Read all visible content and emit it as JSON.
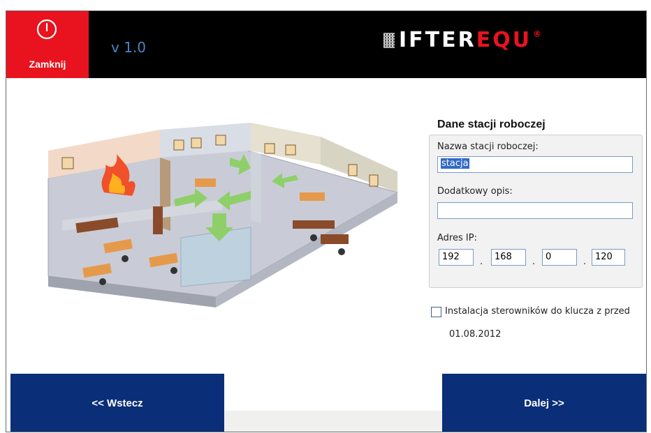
{
  "header": {
    "close_label": "Zamknij",
    "version": "v 1.0",
    "logo_white": "IFTER",
    "logo_red": "EQU",
    "logo_reg": "®"
  },
  "form": {
    "title": "Dane stacji roboczej",
    "station_name_label": "Nazwa stacji roboczej:",
    "station_name_value": "stacja",
    "description_label": "Dodatkowy opis:",
    "description_value": "",
    "ip_label": "Adres IP:",
    "ip": [
      "192",
      "168",
      "0",
      "120"
    ],
    "ip_separator": ".",
    "driver_checkbox_label": "Instalacja sterowników do klucza z przed",
    "driver_checkbox_checked": false,
    "date": "01.08.2012"
  },
  "nav": {
    "back_label": "<< Wstecz",
    "next_label": "Dalej >>"
  },
  "colors": {
    "close_red": "#e8131e",
    "nav_blue": "#0b2e78",
    "version_blue": "#4a86c8"
  },
  "icons": {
    "close": "power-icon",
    "logo": "ifter-logo-icon",
    "illustration": "office-building-illustration"
  }
}
